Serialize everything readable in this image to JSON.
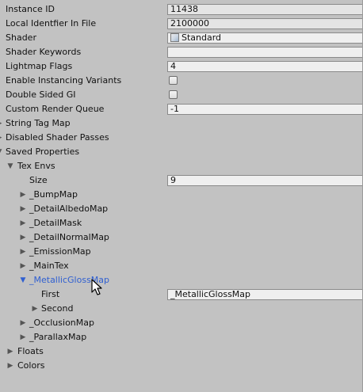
{
  "fields": {
    "instance_id": {
      "label": "Instance ID",
      "value": "11438"
    },
    "local_identifier": {
      "label": "Local Identfier In File",
      "value": "2100000"
    },
    "shader": {
      "label": "Shader",
      "value": "Standard"
    },
    "shader_keywords": {
      "label": "Shader Keywords",
      "value": ""
    },
    "lightmap_flags": {
      "label": "Lightmap Flags",
      "value": "4"
    },
    "enable_instancing": {
      "label": "Enable Instancing Variants",
      "checked": false
    },
    "double_sided_gi": {
      "label": "Double Sided GI",
      "checked": false
    },
    "custom_render_queue": {
      "label": "Custom Render Queue",
      "value": "-1"
    }
  },
  "foldouts": {
    "string_tag_map": "String Tag Map",
    "disabled_shader_passes": "Disabled Shader Passes",
    "saved_properties": "Saved Properties",
    "tex_envs": "Tex Envs",
    "size_label": "Size",
    "size_value": "9",
    "floats": "Floats",
    "colors": "Colors"
  },
  "tex_env_items": [
    "_BumpMap",
    "_DetailAlbedoMap",
    "_DetailMask",
    "_DetailNormalMap",
    "_EmissionMap",
    "_MainTex",
    "_MetallicGlossMap",
    "_OcclusionMap",
    "_ParallaxMap"
  ],
  "metallic_gloss": {
    "first_label": "First",
    "first_value": "_MetallicGlossMap",
    "second_label": "Second"
  },
  "colors": {
    "background": "#c2c2c2",
    "selected_text": "#2f5fd1"
  }
}
